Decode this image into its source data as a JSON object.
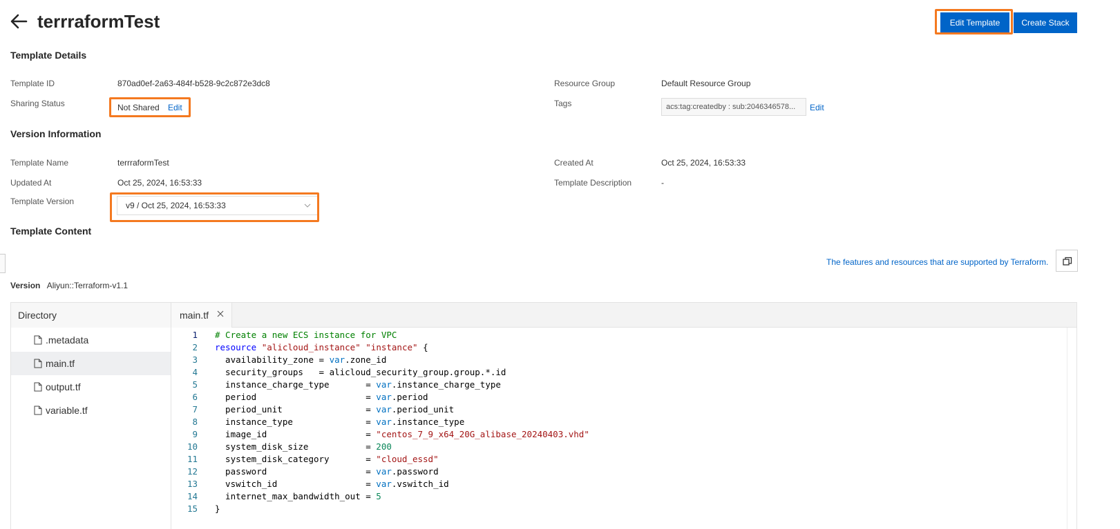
{
  "header": {
    "title": "terrraformTest",
    "edit_template_label": "Edit Template",
    "create_stack_label": "Create Stack"
  },
  "template_details": {
    "section_title": "Template Details",
    "template_id_label": "Template ID",
    "template_id_value": "870ad0ef-2a63-484f-b528-9c2c872e3dc8",
    "sharing_status_label": "Sharing Status",
    "sharing_status_value": "Not Shared",
    "sharing_edit_link": "Edit",
    "resource_group_label": "Resource Group",
    "resource_group_value": "Default Resource Group",
    "tags_label": "Tags",
    "tags_value": "acs:tag:createdby : sub:2046346578...",
    "tags_edit_link": "Edit"
  },
  "version_info": {
    "section_title": "Version Information",
    "template_name_label": "Template Name",
    "template_name_value": "terrraformTest",
    "created_at_label": "Created At",
    "created_at_value": "Oct 25, 2024, 16:53:33",
    "updated_at_label": "Updated At",
    "updated_at_value": "Oct 25, 2024, 16:53:33",
    "description_label": "Template Description",
    "description_value": "-",
    "version_label": "Template Version",
    "version_selected": "v9 / Oct 25, 2024, 16:53:33"
  },
  "template_content": {
    "section_title": "Template Content",
    "supported_link": "The features and resources that are supported by Terraform.",
    "version_label": "Version",
    "version_value": "Aliyun::Terraform-v1.1"
  },
  "editor": {
    "directory_label": "Directory",
    "files": [
      ".metadata",
      "main.tf",
      "output.tf",
      "variable.tf"
    ],
    "active_file": "main.tf",
    "tab_label": "main.tf",
    "code_lines": [
      "# Create a new ECS instance for VPC",
      "resource \"alicloud_instance\" \"instance\" {",
      "  availability_zone = var.zone_id",
      "  security_groups   = alicloud_security_group.group.*.id",
      "  instance_charge_type       = var.instance_charge_type",
      "  period                     = var.period",
      "  period_unit                = var.period_unit",
      "  instance_type              = var.instance_type",
      "  image_id                   = \"centos_7_9_x64_20G_alibase_20240403.vhd\"",
      "  system_disk_size           = 200",
      "  system_disk_category       = \"cloud_essd\"",
      "  password                   = var.password",
      "  vswitch_id                 = var.vswitch_id",
      "  internet_max_bandwidth_out = 5",
      "}"
    ]
  },
  "colors": {
    "primary": "#0064c8",
    "highlight": "#f47920"
  }
}
